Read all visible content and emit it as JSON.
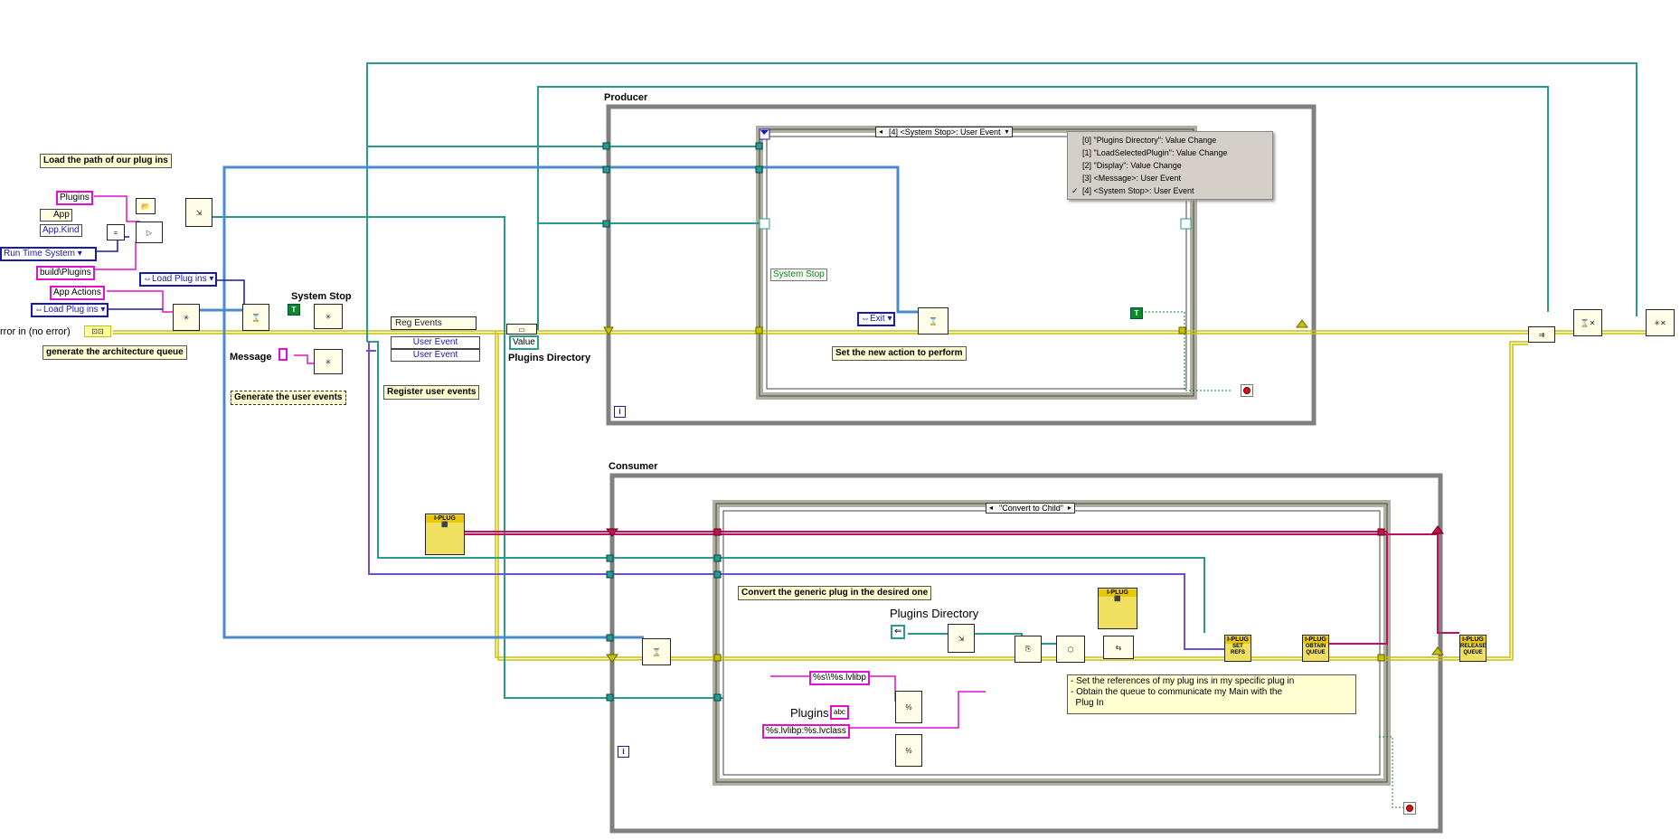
{
  "frames": {
    "producer": {
      "label": "Producer"
    },
    "consumer": {
      "label": "Consumer"
    }
  },
  "comments": {
    "load_path": "Load the path of our plug ins",
    "arch_queue": "generate the architecture queue",
    "gen_user_events": "Generate the user events",
    "register_user_events": "Register user events",
    "set_new_action": "Set the new action to perform",
    "convert_generic": "Convert the generic plug in the desired one",
    "set_references": "- Set the references of my plug ins in my specific plug in\n- Obtain the queue to communicate my Main with the\n  Plug In"
  },
  "labels": {
    "system_stop": "System Stop",
    "message": "Message",
    "error_in": "rror in (no error)",
    "plugins_directory": "Plugins Directory",
    "plugins_directory_consumer": "Plugins Directory",
    "plugins_consumer": "Plugins"
  },
  "constants": {
    "plugins": "Plugins",
    "app": "App",
    "app_kind": "App.Kind",
    "run_time_system": "Run Time System",
    "build_plugins": "build\\Plugins",
    "load_plug_ins_1": "Load Plug ins",
    "app_actions": "App Actions",
    "load_plug_ins_2": "Load Plug ins",
    "reg_events": "Reg Events",
    "user_event_1": "User Event",
    "user_event_2": "User Event",
    "value": "Value",
    "system_stop_const": "System Stop",
    "exit": "Exit",
    "fmt_lvlibp": "%s\\\\%s.lvlibp",
    "fmt_lvclass": "%s.lvlibp:%s.lvclass",
    "abc": "abc",
    "true_const": "T"
  },
  "event_selector": {
    "label": "[4] <System Stop>: User Event",
    "options": [
      {
        "text": "[0] \"Plugins Directory\": Value Change",
        "checked": false
      },
      {
        "text": "[1] \"LoadSelectedPlugin\": Value Change",
        "checked": false
      },
      {
        "text": "[2] \"Display\": Value Change",
        "checked": false
      },
      {
        "text": "[3] <Message>: User Event",
        "checked": false
      },
      {
        "text": "[4] <System Stop>: User Event",
        "checked": true
      }
    ]
  },
  "case_selector": {
    "label": "\"Convert to Child\""
  },
  "subvis": {
    "set_refs": {
      "top": "I-PLUG",
      "bottom": "SET REFS"
    },
    "obtain_queue": {
      "top": "I-PLUG",
      "bottom": "OBTAIN QUEUE"
    },
    "release_queue": {
      "top": "I-PLUG",
      "bottom": "RELEASE QUEUE"
    },
    "class_const_1": {
      "top": "I-PLUG"
    },
    "class_const_2": {
      "top": "I-PLUG"
    }
  },
  "colors": {
    "error_wire": "#c8c000",
    "path_wire": "#2a9a90",
    "queue_wire": "#4a8ad0",
    "string_wire": "#e010d0",
    "class_wire": "#c01060",
    "event_wire": "#7050d0",
    "frame_gray": "#808080"
  }
}
